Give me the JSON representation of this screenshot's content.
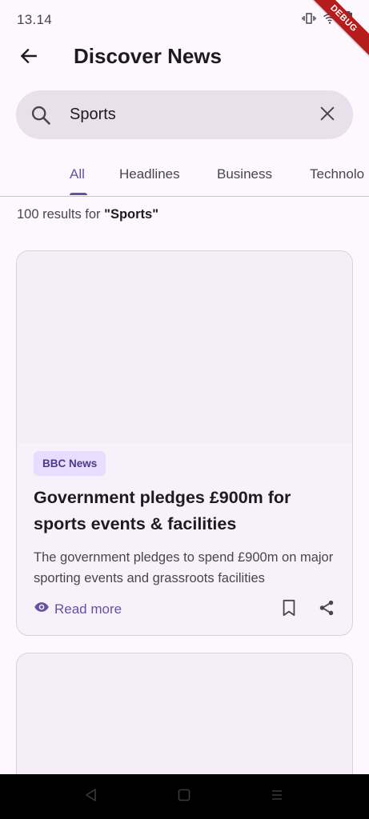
{
  "status_bar": {
    "time": "13.14",
    "icons": [
      "vibrate-icon",
      "wifi-icon",
      "battery-icon"
    ]
  },
  "debug_ribbon": "DEBUG",
  "app_bar": {
    "title": "Discover News",
    "back_icon": "arrow-back-icon"
  },
  "search": {
    "value": "Sports",
    "search_icon": "search-icon",
    "clear_icon": "close-icon"
  },
  "tabs": [
    {
      "label": "All",
      "active": true
    },
    {
      "label": "Headlines",
      "active": false
    },
    {
      "label": "Business",
      "active": false
    },
    {
      "label": "Technolo",
      "active": false
    }
  ],
  "results": {
    "prefix": "100 results for ",
    "query": "\"Sports\""
  },
  "articles": [
    {
      "source": "BBC News",
      "title": "Government pledges £900m for sports events & facilities",
      "description": "The government pledges to spend £900m on major sporting events and grassroots facilities",
      "read_more": "Read more",
      "read_more_icon": "eye-icon",
      "bookmark_icon": "bookmark-icon",
      "share_icon": "share-icon"
    }
  ],
  "system_nav": [
    "back-triangle-icon",
    "home-square-icon",
    "menu-lines-icon"
  ],
  "colors": {
    "primary": "#6750a4",
    "background": "#fdf7fe",
    "search_bg": "#e8e0ea",
    "badge_bg": "#e9ddff",
    "ribbon": "#b71c1c"
  }
}
